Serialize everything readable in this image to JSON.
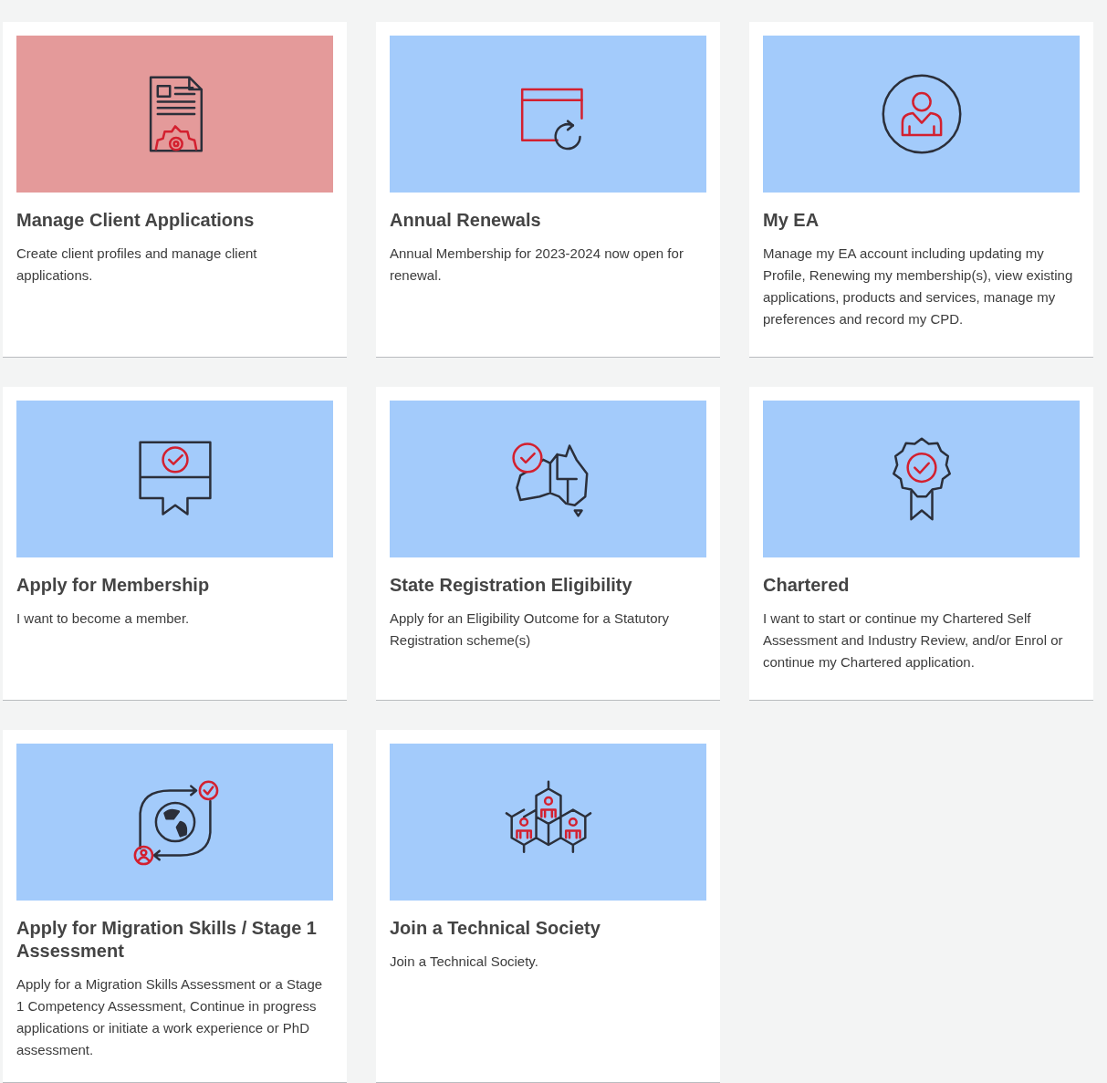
{
  "cards": [
    {
      "title": "Manage Client Applications",
      "description": "Create client profiles and manage client applications.",
      "selected": true
    },
    {
      "title": "Annual Renewals",
      "description": "Annual Membership for 2023-2024 now open for renewal.",
      "selected": false
    },
    {
      "title": "My EA",
      "description": "Manage my EA account including updating my Profile, Renewing my membership(s), view existing applications, products and services, manage my preferences and record my CPD.",
      "selected": false
    },
    {
      "title": "Apply for Membership",
      "description": "I want to become a member.",
      "selected": false
    },
    {
      "title": "State Registration Eligibility",
      "description": "Apply for an Eligibility Outcome for a Statutory Registration scheme(s)",
      "selected": false
    },
    {
      "title": "Chartered",
      "description": "I want to start or continue my Chartered Self Assessment and Industry Review, and/or Enrol or continue my Chartered application.",
      "selected": false
    },
    {
      "title": "Apply for Migration Skills / Stage 1 Assessment",
      "description": "Apply for a Migration Skills Assessment or a Stage 1 Competency Assessment, Continue in progress applications or initiate a work experience or PhD assessment.",
      "selected": false
    },
    {
      "title": "Join a Technical Society",
      "description": "Join a Technical Society.",
      "selected": false
    }
  ]
}
